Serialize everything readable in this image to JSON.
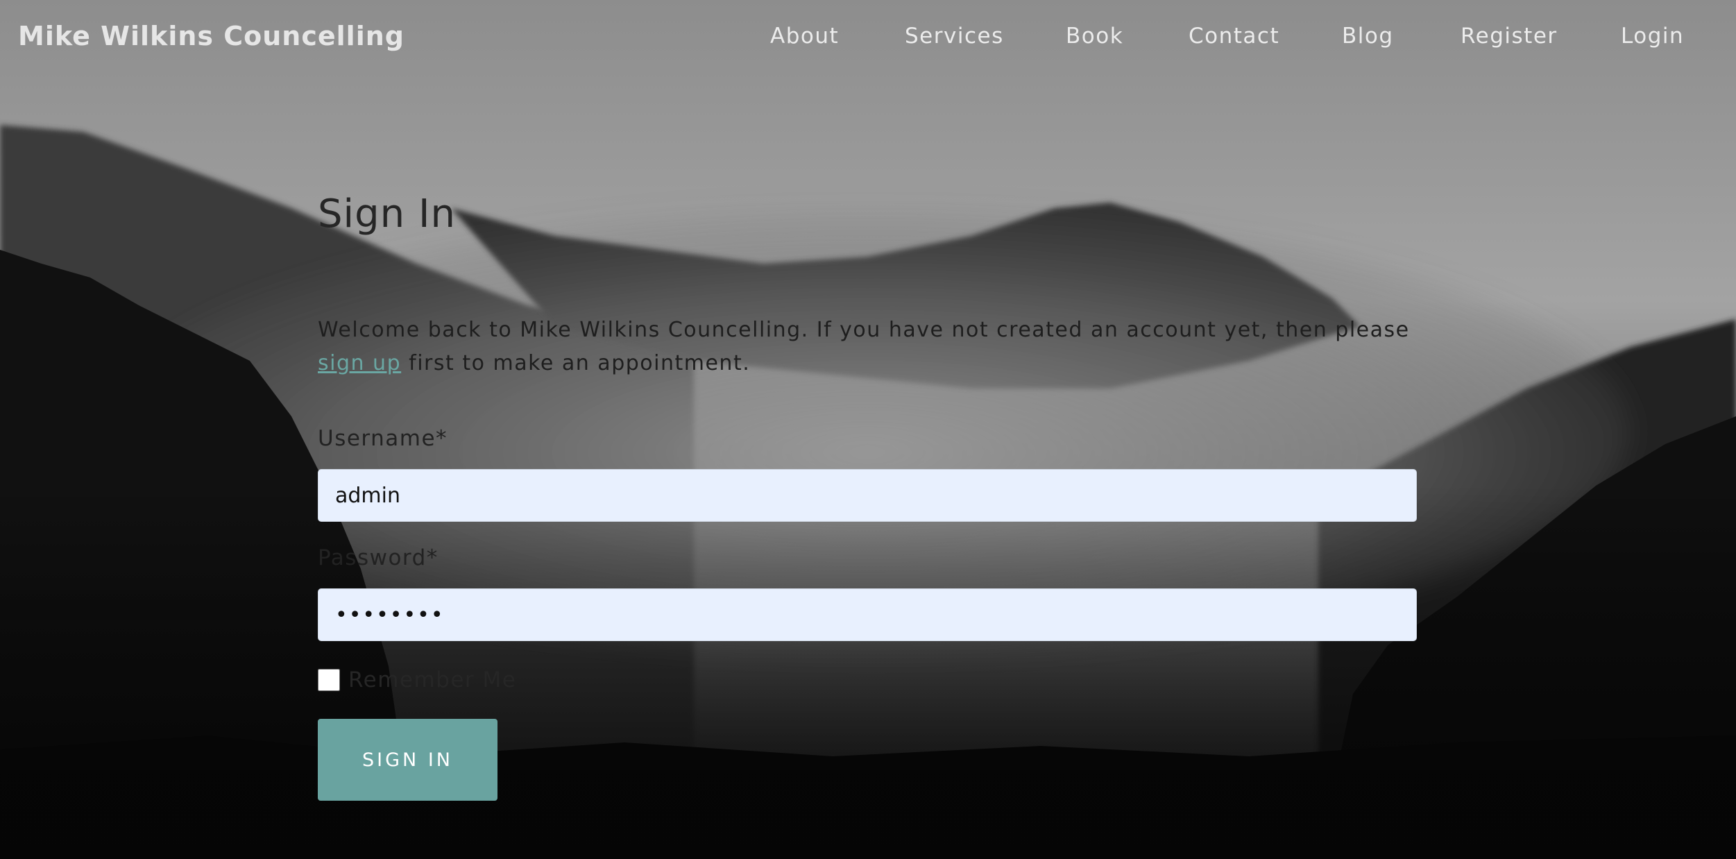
{
  "navbar": {
    "brand": "Mike Wilkins Councelling",
    "links": [
      "About",
      "Services",
      "Book",
      "Contact",
      "Blog",
      "Register",
      "Login"
    ]
  },
  "signin": {
    "title": "Sign In",
    "intro_before": "Welcome back to Mike Wilkins Councelling. If you have not created an account yet, then please ",
    "intro_link": "sign up",
    "intro_after": " first to make an appointment.",
    "username_label": "Username*",
    "username_value": "admin",
    "password_label": "Password*",
    "password_value": "••••••••",
    "remember_label": "Remember Me",
    "remember_checked": false,
    "button_label": "SIGN IN"
  },
  "colors": {
    "accent": "#69a3a0",
    "link": "#6aa7a3",
    "input_bg": "#e8f0fe"
  }
}
